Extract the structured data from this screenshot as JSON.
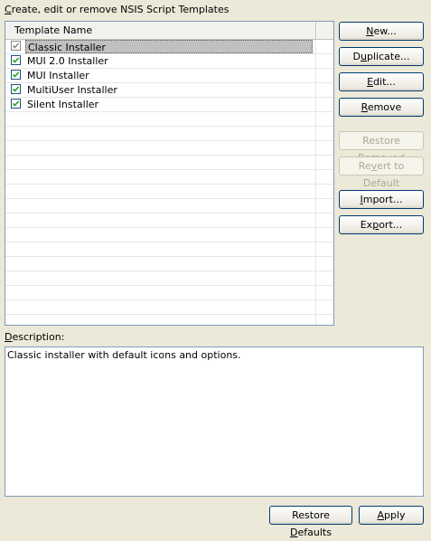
{
  "heading": {
    "pre": "",
    "accel": "C",
    "post": "reate, edit or remove NSIS Script Templates"
  },
  "table": {
    "column_header": "Template Name",
    "rows": [
      {
        "label": "Classic Installer",
        "checked": true,
        "selected": true
      },
      {
        "label": "MUI 2.0 Installer",
        "checked": true,
        "selected": false
      },
      {
        "label": "MUI Installer",
        "checked": true,
        "selected": false
      },
      {
        "label": "MultiUser Installer",
        "checked": true,
        "selected": false
      },
      {
        "label": "Silent Installer",
        "checked": true,
        "selected": false
      }
    ]
  },
  "buttons": {
    "new": {
      "pre": "",
      "accel": "N",
      "post": "ew..."
    },
    "duplicate": {
      "pre": "D",
      "accel": "u",
      "post": "plicate..."
    },
    "edit": {
      "pre": "",
      "accel": "E",
      "post": "dit..."
    },
    "remove": {
      "pre": "",
      "accel": "R",
      "post": "emove"
    },
    "restore_removed": {
      "pre": "Restore Re",
      "accel": "m",
      "post": "oved"
    },
    "revert_to_default": {
      "pre": "Re",
      "accel": "v",
      "post": "ert to Default"
    },
    "import": {
      "pre": "",
      "accel": "I",
      "post": "mport..."
    },
    "export": {
      "pre": "Ex",
      "accel": "p",
      "post": "ort..."
    },
    "restore_defaults": {
      "pre": "Restore ",
      "accel": "D",
      "post": "efaults"
    },
    "apply": {
      "pre": "",
      "accel": "A",
      "post": "pply"
    }
  },
  "description": {
    "label": {
      "pre": "",
      "accel": "D",
      "post": "escription:"
    },
    "text": "Classic installer with default icons and options."
  },
  "colors": {
    "window_bg": "#ece9d8",
    "border": "#7f9db9",
    "check_green": "#21a121",
    "selection_gray": "#c0c0c0",
    "disabled_text": "#aca899"
  }
}
